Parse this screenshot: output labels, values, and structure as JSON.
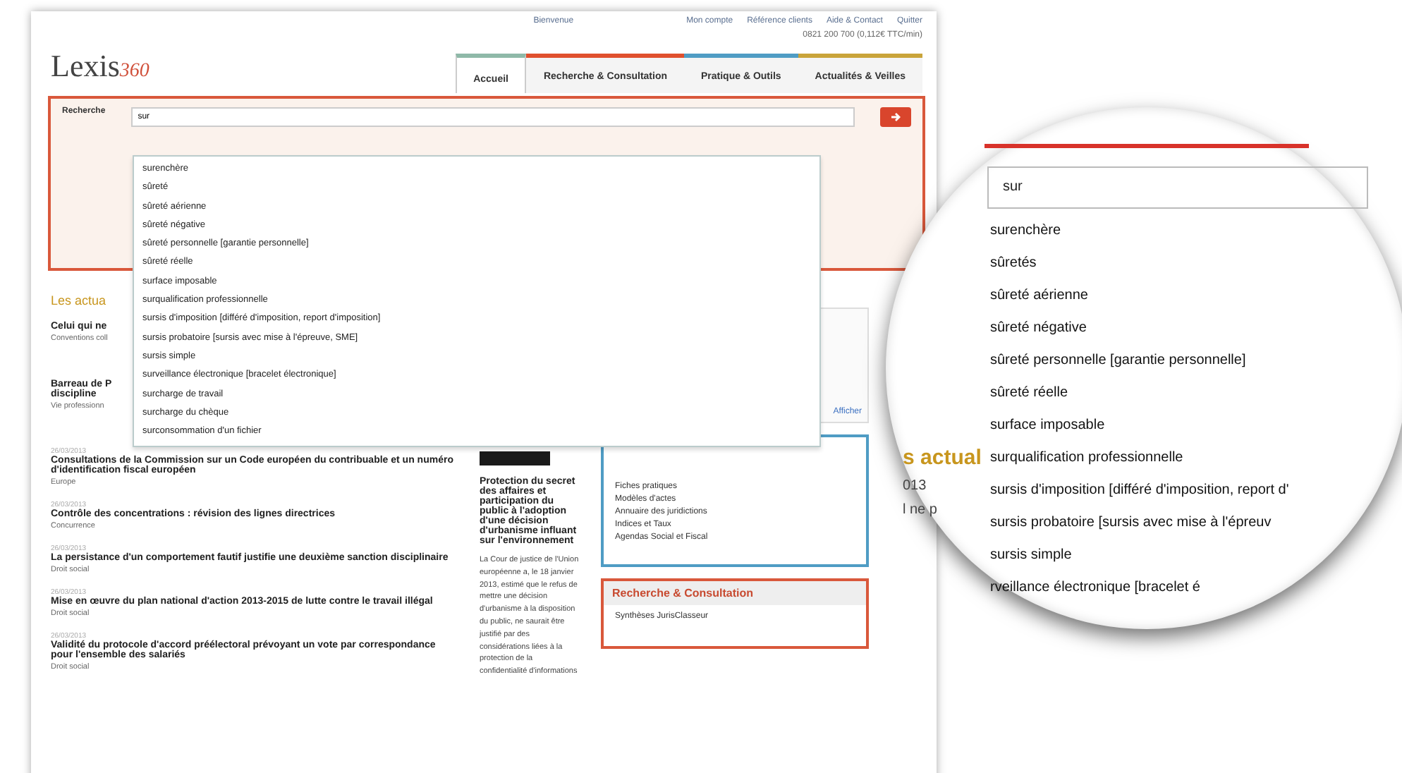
{
  "top_links": [
    "Bienvenue",
    "Mon compte",
    "Référence clients",
    "Aide & Contact",
    "Quitter"
  ],
  "phone": "0821 200 700 (0,112€ TTC/min)",
  "logo": {
    "word": "Lexis",
    "suffix": "360"
  },
  "tabs": [
    {
      "label": "Accueil",
      "selected": true,
      "color": "#8fb9a8"
    },
    {
      "label": "Recherche & Consultation",
      "selected": false,
      "color": "#e0502e"
    },
    {
      "label": "Pratique & Outils",
      "selected": false,
      "color": "#4f9cc4"
    },
    {
      "label": "Actualités & Veilles",
      "selected": false,
      "color": "#c9a43a"
    }
  ],
  "search": {
    "label": "Recherche",
    "value": "sur"
  },
  "suggestions": [
    "surenchère",
    "sûreté",
    "sûreté aérienne",
    "sûreté négative",
    "sûreté personnelle [garantie personnelle]",
    "sûreté réelle",
    "surface imposable",
    "surqualification professionnelle",
    "sursis d'imposition [différé d'imposition, report d'imposition]",
    "sursis probatoire [sursis avec mise à l'épreuve, SME]",
    "sursis simple",
    "surveillance électronique [bracelet électronique]",
    "surcharge de travail",
    "surcharge du chèque",
    "surconsommation d'un fichier"
  ],
  "news": {
    "heading": "Les actua",
    "hidden_items": [
      {
        "title": "Celui qui ne",
        "category": "Conventions coll"
      },
      {
        "title": "Barreau de P",
        "extra": "discipline",
        "category": "Vie professionn"
      }
    ],
    "items": [
      {
        "date": "26/03/2013",
        "title": "Consultations de la Commission sur un Code européen du contribuable et un numéro d'identification fiscal européen",
        "category": "Europe"
      },
      {
        "date": "26/03/2013",
        "title": "Contrôle des concentrations : révision des lignes directrices",
        "category": "Concurrence"
      },
      {
        "date": "26/03/2013",
        "title": "La persistance d'un comportement fautif justifie une deuxième sanction disciplinaire",
        "category": "Droit social"
      },
      {
        "date": "26/03/2013",
        "title": "Mise en œuvre du plan national d'action 2013-2015 de lutte contre le travail illégal",
        "category": "Droit social"
      },
      {
        "date": "26/03/2013",
        "title": "Validité du protocole d'accord préélectoral prévoyant un vote par correspondance pour l'ensemble des salariés",
        "category": "Droit social"
      }
    ]
  },
  "feature": {
    "title": "Protection du secret des affaires et participation du public à l'adoption d'une décision d'urbanisme influant sur l'environnement",
    "text": "La Cour de justice de l'Union européenne a, le 18 janvier 2013, estimé que le refus de mettre une décision d'urbanisme à la disposition du public, ne saurait être justifié par des considérations liées à la protection de la confidentialité d'informations"
  },
  "info_link": "Afficher",
  "tools_box": {
    "items": [
      "Fiches pratiques",
      "Modèles d'actes",
      "Annuaire des juridictions",
      "Indices et Taux",
      "Agendas Social et Fiscal"
    ]
  },
  "research_box": {
    "title": "Recherche & Consultation",
    "items": [
      "Synthèses JurisClasseur"
    ]
  },
  "magnifier": {
    "side_texts": [
      "s actual",
      "013",
      "l ne p"
    ],
    "value": "sur",
    "suggestions": [
      "surenchère",
      "sûretés",
      "sûreté aérienne",
      "sûreté négative",
      "sûreté personnelle [garantie personnelle]",
      "sûreté réelle",
      "surface imposable",
      "surqualification professionnelle",
      "sursis d'imposition [différé d'imposition, report d'",
      "sursis probatoire [sursis avec mise à l'épreuv",
      "sursis simple",
      "rveillance électronique [bracelet é"
    ]
  }
}
